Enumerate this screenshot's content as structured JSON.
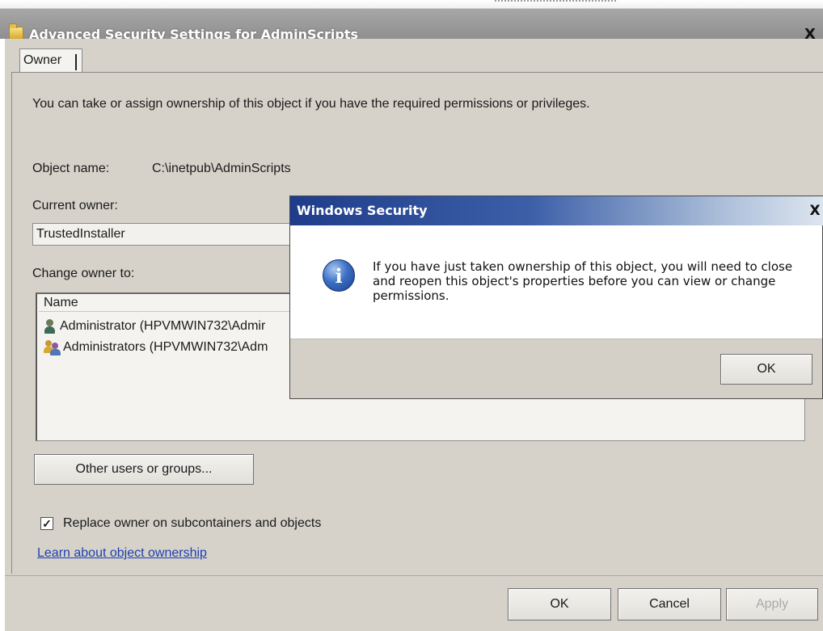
{
  "window": {
    "title": "Advanced Security Settings for AdminScripts",
    "close_glyph": "X",
    "title_icon": "folder-icon"
  },
  "tabs": [
    {
      "label": "Owner",
      "selected": true
    }
  ],
  "owner_tab": {
    "intro": "You can take or assign ownership of this object if you have the required permissions or privileges.",
    "object_name_label": "Object name:",
    "object_name_value": "C:\\inetpub\\AdminScripts",
    "current_owner_label": "Current owner:",
    "current_owner_value": "TrustedInstaller",
    "change_owner_label": "Change owner to:",
    "list_header": "Name",
    "list_items": [
      {
        "label": "Administrator (HPVMWIN732\\Admir",
        "icon": "user-icon"
      },
      {
        "label": "Administrators (HPVMWIN732\\Adm",
        "icon": "group-icon"
      }
    ],
    "other_users_button": "Other users or groups...",
    "replace_owner_checkbox": {
      "label": "Replace owner on subcontainers and objects",
      "checked": true,
      "mark": "✓"
    },
    "learn_link": "Learn about object ownership"
  },
  "footer_buttons": {
    "ok": "OK",
    "cancel": "Cancel",
    "apply": "Apply"
  },
  "security_dialog": {
    "title": "Windows Security",
    "close_glyph": "X",
    "icon": "info-icon",
    "icon_glyph": "i",
    "message": "If you have just taken ownership of this object, you will need to close and reopen this object's properties before you can view or change permissions.",
    "ok": "OK"
  },
  "colors": {
    "dialog_title_start": "#1f3c8a",
    "link": "#1c3fb0",
    "window_bg": "#d4d0c8"
  }
}
